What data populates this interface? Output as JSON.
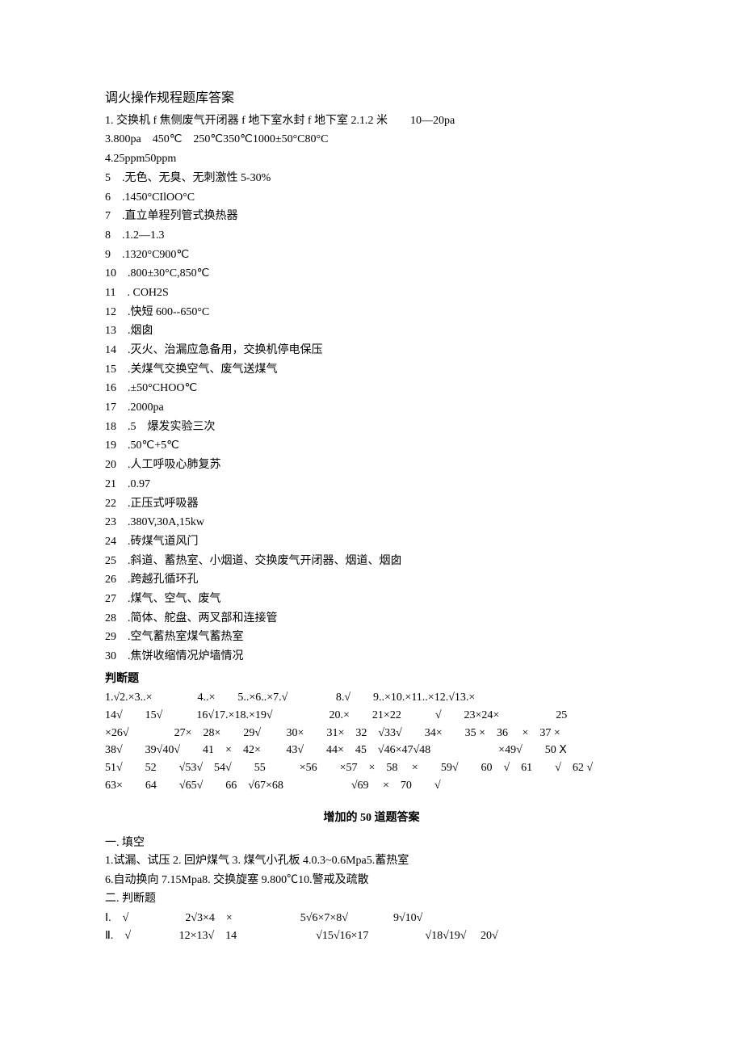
{
  "title": "调火操作规程题库答案",
  "fill1": [
    "1. 交换机 f 焦侧废气开闭器 f 地下室水封 f 地下室 2.1.2 米  10—20pa",
    "3.800pa 450℃ 250℃350℃1000±50°C80°C",
    "4.25ppm50ppm",
    "5 .无色、无臭、无刺激性 5-30%",
    "6 .1450°CIlOO°C",
    "7 .直立单程列管式换热器",
    "8 .1.2—1.3",
    "9 .1320°C900℃",
    "10 .800±30°C,850℃",
    "11 . COH2S",
    "12 .快短 600--650°C",
    "13 .烟囱",
    "14 .灭火、治漏应急备用，交换机停电保压",
    "15 .关煤气交换空气、废气送煤气",
    "16 .±50°CHOO℃",
    "17 .2000pa",
    "18 .5 爆发实验三次",
    "19 .50℃+5℃",
    "20 .人工呼吸心肺复苏",
    "21 .0.97",
    "22 .正压式呼吸器",
    "23 .380V,30A,15kw",
    "24 .砖煤气道风门",
    "25 .斜道、蓄热室、小烟道、交换废气开闭器、烟道、烟囱",
    "26 .跨越孔循环孔",
    "27 .煤气、空气、废气",
    "28 .简体、舵盘、两叉部和连接管",
    "29 .空气蓄热室煤气蓄热室",
    "30 .焦饼收缩情况炉墙情况"
  ],
  "judgment_label": "判断题",
  "judgment_lines": [
    "1.√2.×3..×    4..×  5..×6..×7.√     8.√  9..×10.×11..×12.√13.×",
    "14√  15√   16√17.×18.×19√     20.×  21×22   √  23×24×     25",
    "×26√    27× 28×  29√   30×  31× 32 √33√  34×  35 × 36  × 37 ×",
    "38√  39√40√  41 × 42×   43√  44× 45 √46×47√48      ×49√  50 Ⅹ",
    "51√  52  √53√ 54√  55   ×56  ×57 × 58  ×  59√  60 √ 61  √ 62 √",
    "63×  64  √65√  66 √67×68      √69  × 70  √"
  ],
  "added_title": "增加的 50 道题答案",
  "fill2_label": "一. 填空",
  "fill2_lines": [
    "1.试漏、试压 2. 回炉煤气 3. 煤气小孔板 4.0.3~0.6Mpa5.蓄热室",
    "6.自动换向 7.15Mpa8. 交换旋塞 9.800℃10.警戒及疏散"
  ],
  "judgment2_label": "二. 判断题",
  "judgment2_lines": [
    "Ⅰ. √     2√3×4 ×      5√6×7×8√    9√10√",
    "Ⅱ. √     12×13√ 14       √15√16×17     √18√19√  20√"
  ]
}
